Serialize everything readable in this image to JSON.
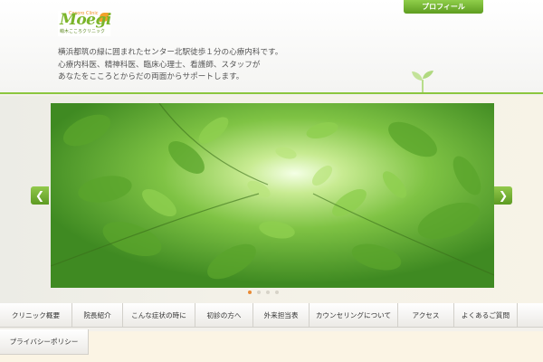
{
  "header": {
    "logo": {
      "name": "Moegi",
      "tagline": "Cocoro Clinic",
      "subtitle": "萌木こころクリニック"
    },
    "profile_button": "プロフィール",
    "description": [
      "横浜都筑の緑に囲まれたセンター北駅徒歩１分の心療内科です。",
      "心療内科医、精神科医、臨床心理士、看護師、スタッフが",
      "あなたをこころとからだの両面からサポートします。"
    ]
  },
  "slider": {
    "prev_icon": "chevron-left-icon",
    "next_icon": "chevron-right-icon",
    "prev_glyph": "❮",
    "next_glyph": "❯",
    "image": "green-leaves-canopy",
    "dots": [
      {
        "active": true
      },
      {
        "active": false
      },
      {
        "active": false
      },
      {
        "active": false
      }
    ]
  },
  "nav": {
    "row1": [
      "クリニック概要",
      "院長紹介",
      "こんな症状の時に",
      "初診の方へ",
      "外来担当表",
      "カウンセリングについて",
      "アクセス",
      "よくあるご質問"
    ],
    "row2": [
      "プライバシーポリシー"
    ]
  },
  "colors": {
    "accent_green": "#8cc63f",
    "button_green": "#5e9d20",
    "active_dot": "#e98a35"
  }
}
